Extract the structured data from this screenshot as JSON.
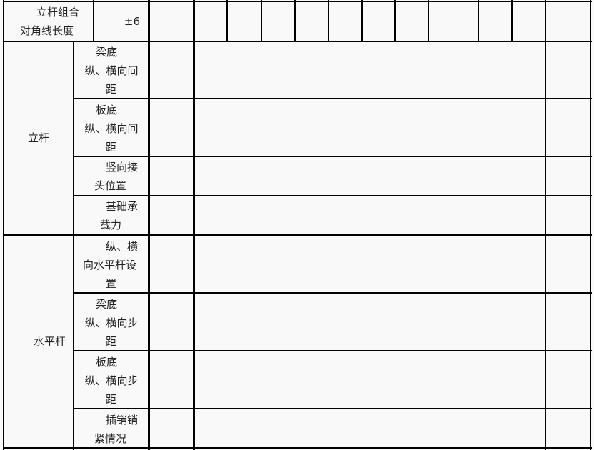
{
  "top_row": {
    "item_line1": "立杆组合",
    "item_line2": "对角线长度",
    "tolerance": "±6"
  },
  "groups": [
    {
      "name": "立杆",
      "items": [
        {
          "line1": "梁底",
          "line2": "纵、横向间",
          "line3": "距"
        },
        {
          "line1": "板底",
          "line2": "纵、横向间",
          "line3": "距"
        },
        {
          "line1": "竖向接",
          "line2": "头位置",
          "line3": ""
        },
        {
          "line1": "基础承",
          "line2": "载力",
          "line3": ""
        }
      ]
    },
    {
      "name": "水平杆",
      "items": [
        {
          "line1": "纵、横",
          "line2": "向水平杆设",
          "line3": "置"
        },
        {
          "line1": "梁底",
          "line2": "纵、横向步",
          "line3": "距"
        },
        {
          "line1": "板底",
          "line2": "纵、横向步",
          "line3": "距"
        },
        {
          "line1": "插销销",
          "line2": "紧情况",
          "line3": ""
        }
      ]
    }
  ]
}
